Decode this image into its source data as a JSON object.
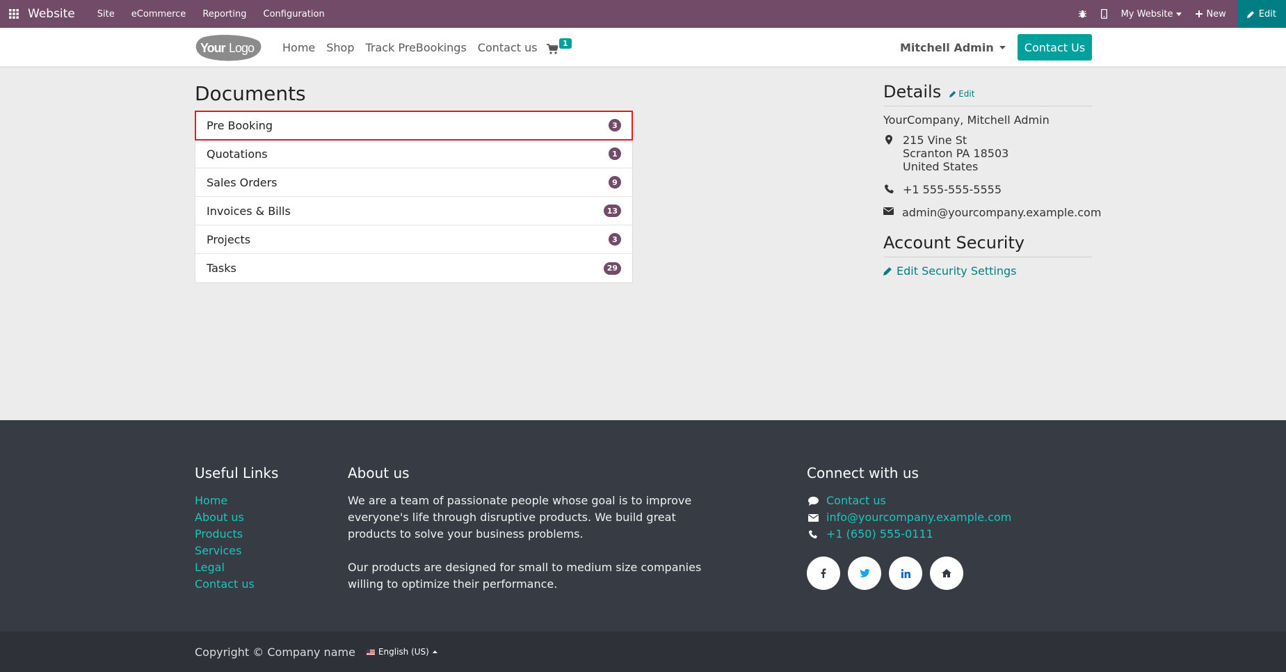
{
  "topbar": {
    "brand": "Website",
    "menu": [
      "Site",
      "eCommerce",
      "Reporting",
      "Configuration"
    ],
    "website_selector": "My Website",
    "new_label": "New",
    "edit_label": "Edit"
  },
  "header": {
    "logo_text": "YourLogo",
    "nav": [
      "Home",
      "Shop",
      "Track PreBookings",
      "Contact us"
    ],
    "cart_count": "1",
    "user_name": "Mitchell Admin",
    "contact_button": "Contact Us"
  },
  "documents": {
    "title": "Documents",
    "items": [
      {
        "label": "Pre Booking",
        "count": "3"
      },
      {
        "label": "Quotations",
        "count": "1"
      },
      {
        "label": "Sales Orders",
        "count": "9"
      },
      {
        "label": "Invoices & Bills",
        "count": "13"
      },
      {
        "label": "Projects",
        "count": "3"
      },
      {
        "label": "Tasks",
        "count": "29"
      }
    ]
  },
  "details": {
    "title": "Details",
    "edit_label": "Edit",
    "company": "YourCompany, Mitchell Admin",
    "address": [
      "215 Vine St",
      "Scranton PA 18503",
      "United States"
    ],
    "phone": "+1 555-555-5555",
    "email": "admin@yourcompany.example.com"
  },
  "security": {
    "title": "Account Security",
    "link": "Edit Security Settings"
  },
  "footer": {
    "useful_links_title": "Useful Links",
    "useful_links": [
      "Home",
      "About us",
      "Products",
      "Services",
      "Legal",
      "Contact us"
    ],
    "about_title": "About us",
    "about_p1": "We are a team of passionate people whose goal is to improve everyone's life through disruptive products. We build great products to solve your business problems.",
    "about_p2": "Our products are designed for small to medium size companies willing to optimize their performance.",
    "connect_title": "Connect with us",
    "connect_contact": "Contact us",
    "connect_email": "info@yourcompany.example.com",
    "connect_phone": "+1 (650) 555-0111",
    "social_icons": [
      "facebook-icon",
      "twitter-icon",
      "linkedin-icon",
      "home-icon"
    ],
    "copyright": "Copyright © Company name",
    "language": "English (US)"
  },
  "colors": {
    "topbar": "#714b67",
    "accent": "#00a09d",
    "edit": "#017e84",
    "footer": "#373b43",
    "highlight": "#e01b1b"
  }
}
